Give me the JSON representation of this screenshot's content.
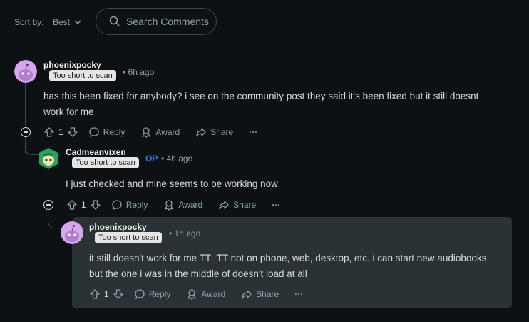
{
  "sort": {
    "label": "Sort by:",
    "value": "Best"
  },
  "search": {
    "placeholder": "Search Comments"
  },
  "comments": [
    {
      "username": "phoenixpocky",
      "badge": "Too short to scan",
      "time": "6h ago",
      "text_line1": "has this been fixed for anybody? i see on the community post they said it's been fixed but it still doesnt",
      "text_line2": "work for me",
      "votes": "1",
      "reply": "Reply",
      "award": "Award",
      "share": "Share",
      "more": "···"
    },
    {
      "username": "Cadmeanvixen",
      "badge": "Too short to scan",
      "op": "OP",
      "time": "4h ago",
      "text_line1": "I just checked and mine seems to be working now",
      "votes": "1",
      "reply": "Reply",
      "award": "Award",
      "share": "Share",
      "more": "···"
    },
    {
      "username": "phoenixpocky",
      "badge": "Too short to scan",
      "time": "1h ago",
      "text_line1": "it still doesn't work for me TT_TT not on phone, web, desktop, etc. i can start new audiobooks",
      "text_line2": "but the one i was in the middle of doesn't load at all",
      "votes": "1",
      "reply": "Reply",
      "award": "Award",
      "share": "Share",
      "more": "···"
    }
  ],
  "colors": {
    "background": "#0e1113",
    "highlight": "#2a3236",
    "op": "#2f7ae5",
    "avatar_purple": "#d8a6f0"
  }
}
